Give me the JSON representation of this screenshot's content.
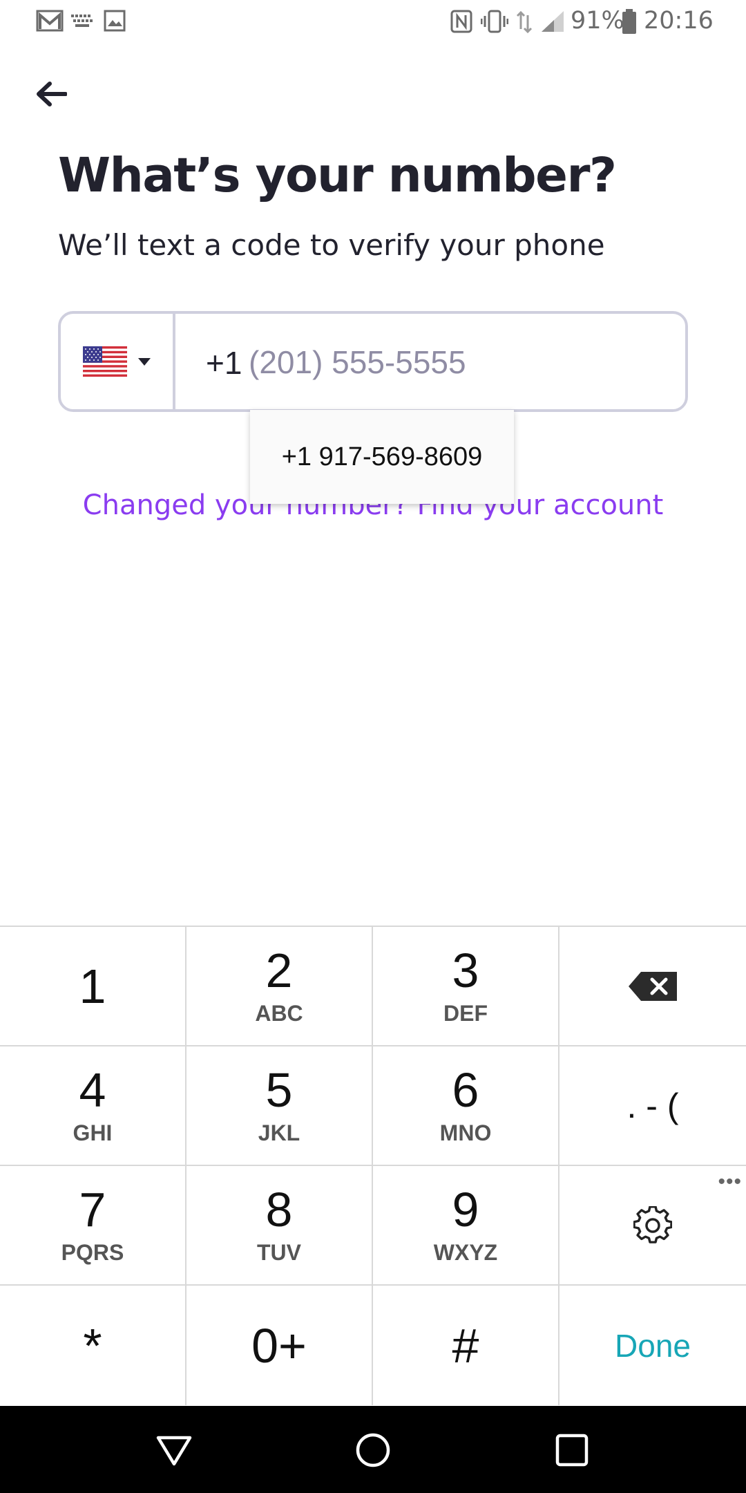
{
  "status_bar": {
    "battery": "91%",
    "time": "20:16",
    "icons": [
      "gmail-icon",
      "keyboard-icon",
      "image-icon",
      "nfc-icon",
      "vibrate-icon",
      "data-icon",
      "signal-icon",
      "battery-icon"
    ]
  },
  "header": {
    "back_icon": "arrow-left-icon",
    "title": "What’s your number?",
    "subtitle": "We’ll text a code to verify your phone"
  },
  "phone": {
    "country_flag": "us-flag-icon",
    "dial_code": "+1",
    "placeholder": "(201) 555-5555",
    "value": ""
  },
  "suggestion": {
    "text": "+1 917-569-8609"
  },
  "link": {
    "text": "Changed your number? Find your account",
    "color": "#8a3cf0"
  },
  "keyboard": {
    "rows": [
      [
        {
          "digit": "1",
          "letters": ""
        },
        {
          "digit": "2",
          "letters": "ABC"
        },
        {
          "digit": "3",
          "letters": "DEF"
        },
        {
          "icon": "backspace-icon"
        }
      ],
      [
        {
          "digit": "4",
          "letters": "GHI"
        },
        {
          "digit": "5",
          "letters": "JKL"
        },
        {
          "digit": "6",
          "letters": "MNO"
        },
        {
          "symbols": ". - ("
        }
      ],
      [
        {
          "digit": "7",
          "letters": "PQRS"
        },
        {
          "digit": "8",
          "letters": "TUV"
        },
        {
          "digit": "9",
          "letters": "WXYZ"
        },
        {
          "icon": "gear-icon"
        }
      ],
      [
        {
          "digit": "*",
          "letters": ""
        },
        {
          "digit": "0+",
          "letters": ""
        },
        {
          "digit": "#",
          "letters": ""
        },
        {
          "action": "Done"
        }
      ]
    ],
    "more": "•••",
    "done_color": "#17a6b6"
  },
  "nav_bar": {
    "buttons": [
      "back-triangle-icon",
      "home-circle-icon",
      "recents-square-icon"
    ]
  }
}
